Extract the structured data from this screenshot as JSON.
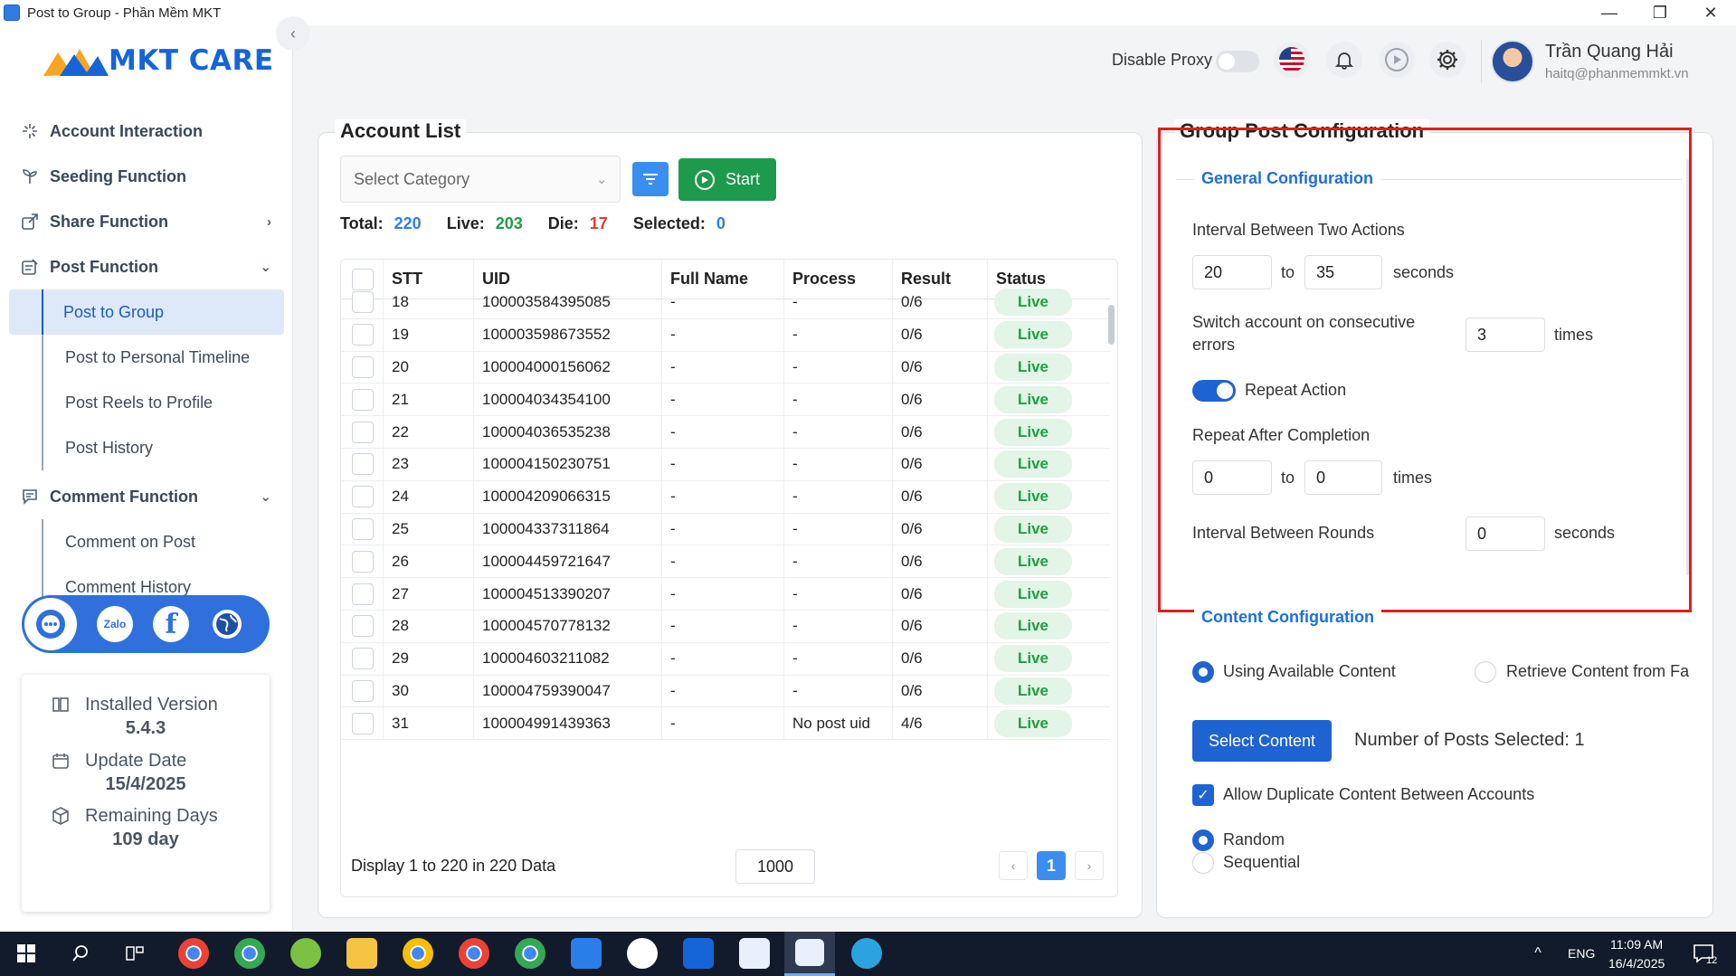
{
  "window": {
    "title": "Post to Group - Phần Mềm MKT",
    "minimize": "—",
    "maximize": "❐",
    "close": "✕"
  },
  "brand": {
    "logo_text": "MKT CARE"
  },
  "sidebar": {
    "collapse_icon": "‹",
    "items": [
      {
        "label": "Account Interaction",
        "icon": "sparkle-icon"
      },
      {
        "label": "Seeding Function",
        "icon": "seedling-icon"
      },
      {
        "label": "Share Function",
        "icon": "share-icon",
        "chevron": "›"
      },
      {
        "label": "Post Function",
        "icon": "post-icon",
        "chevron": "⌄"
      },
      {
        "label": "Comment Function",
        "icon": "comment-icon",
        "chevron": "⌄"
      }
    ],
    "post_sub": [
      "Post to Group",
      "Post to Personal Timeline",
      "Post Reels to Profile",
      "Post History"
    ],
    "comment_sub": [
      "Comment on Post",
      "Comment History"
    ]
  },
  "social": {
    "zalo": "Zalo"
  },
  "version": {
    "installed_label": "Installed Version",
    "installed_value": "5.4.3",
    "update_label": "Update Date",
    "update_value": "15/4/2025",
    "remaining_label": "Remaining Days",
    "remaining_value": "109 day"
  },
  "header": {
    "proxy_label": "Disable Proxy",
    "user_name": "Trần Quang Hải",
    "user_email": "haitq@phanmemmkt.vn"
  },
  "account_list": {
    "title": "Account List",
    "category_placeholder": "Select Category",
    "start_label": "Start",
    "stats": {
      "total_label": "Total:",
      "total": "220",
      "live_label": "Live:",
      "live": "203",
      "die_label": "Die:",
      "die": "17",
      "selected_label": "Selected:",
      "selected": "0"
    },
    "columns": [
      "STT",
      "UID",
      "Full Name",
      "Process",
      "Result",
      "Status"
    ],
    "rows": [
      {
        "stt": "18",
        "uid": "100003584395085",
        "name": "-",
        "process": "-",
        "result": "0/6",
        "status": "Live"
      },
      {
        "stt": "19",
        "uid": "100003598673552",
        "name": "-",
        "process": "-",
        "result": "0/6",
        "status": "Live"
      },
      {
        "stt": "20",
        "uid": "100004000156062",
        "name": "-",
        "process": "-",
        "result": "0/6",
        "status": "Live"
      },
      {
        "stt": "21",
        "uid": "100004034354100",
        "name": "-",
        "process": "-",
        "result": "0/6",
        "status": "Live"
      },
      {
        "stt": "22",
        "uid": "100004036535238",
        "name": "-",
        "process": "-",
        "result": "0/6",
        "status": "Live"
      },
      {
        "stt": "23",
        "uid": "100004150230751",
        "name": "-",
        "process": "-",
        "result": "0/6",
        "status": "Live"
      },
      {
        "stt": "24",
        "uid": "100004209066315",
        "name": "-",
        "process": "-",
        "result": "0/6",
        "status": "Live"
      },
      {
        "stt": "25",
        "uid": "100004337311864",
        "name": "-",
        "process": "-",
        "result": "0/6",
        "status": "Live"
      },
      {
        "stt": "26",
        "uid": "100004459721647",
        "name": "-",
        "process": "-",
        "result": "0/6",
        "status": "Live"
      },
      {
        "stt": "27",
        "uid": "100004513390207",
        "name": "-",
        "process": "-",
        "result": "0/6",
        "status": "Live"
      },
      {
        "stt": "28",
        "uid": "100004570778132",
        "name": "-",
        "process": "-",
        "result": "0/6",
        "status": "Live"
      },
      {
        "stt": "29",
        "uid": "100004603211082",
        "name": "-",
        "process": "-",
        "result": "0/6",
        "status": "Live"
      },
      {
        "stt": "30",
        "uid": "100004759390047",
        "name": "-",
        "process": "-",
        "result": "0/6",
        "status": "Live"
      },
      {
        "stt": "31",
        "uid": "100004991439363",
        "name": "-",
        "process": "No post uid",
        "result": "4/6",
        "status": "Live"
      }
    ],
    "footer_text": "Display 1 to 220 in 220 Data",
    "page_size": "1000",
    "prev": "‹",
    "current_page": "1",
    "next": "›"
  },
  "config": {
    "title": "Group Post Configuration",
    "general_title": "General Configuration",
    "interval_label": "Interval Between Two Actions",
    "interval_from": "20",
    "interval_to": "35",
    "to_label": "to",
    "seconds_label": "seconds",
    "switch_label_1": "Switch account on consecutive",
    "switch_label_2": "errors",
    "switch_value": "3",
    "times_label": "times",
    "repeat_action_label": "Repeat Action",
    "repeat_after_label": "Repeat After Completion",
    "repeat_from": "0",
    "repeat_to": "0",
    "rounds_label": "Interval Between Rounds",
    "rounds_value": "0",
    "content_title": "Content Configuration",
    "using_content_label": "Using Available Content",
    "retrieve_label": "Retrieve Content from Fa",
    "select_content_label": "Select Content",
    "posts_selected": "Number of Posts Selected: 1",
    "allow_dup_label": "Allow Duplicate Content Between Accounts",
    "random_label": "Random",
    "sequential_label": "Sequential"
  },
  "taskbar": {
    "lang": "ENG",
    "time": "11:09 AM",
    "date": "16/4/2025",
    "notif_count": "12"
  },
  "colors": {
    "primary": "#1e63d2",
    "live_green": "#1f9d45",
    "die_red": "#e53935",
    "highlight_red": "#e01e1e"
  }
}
